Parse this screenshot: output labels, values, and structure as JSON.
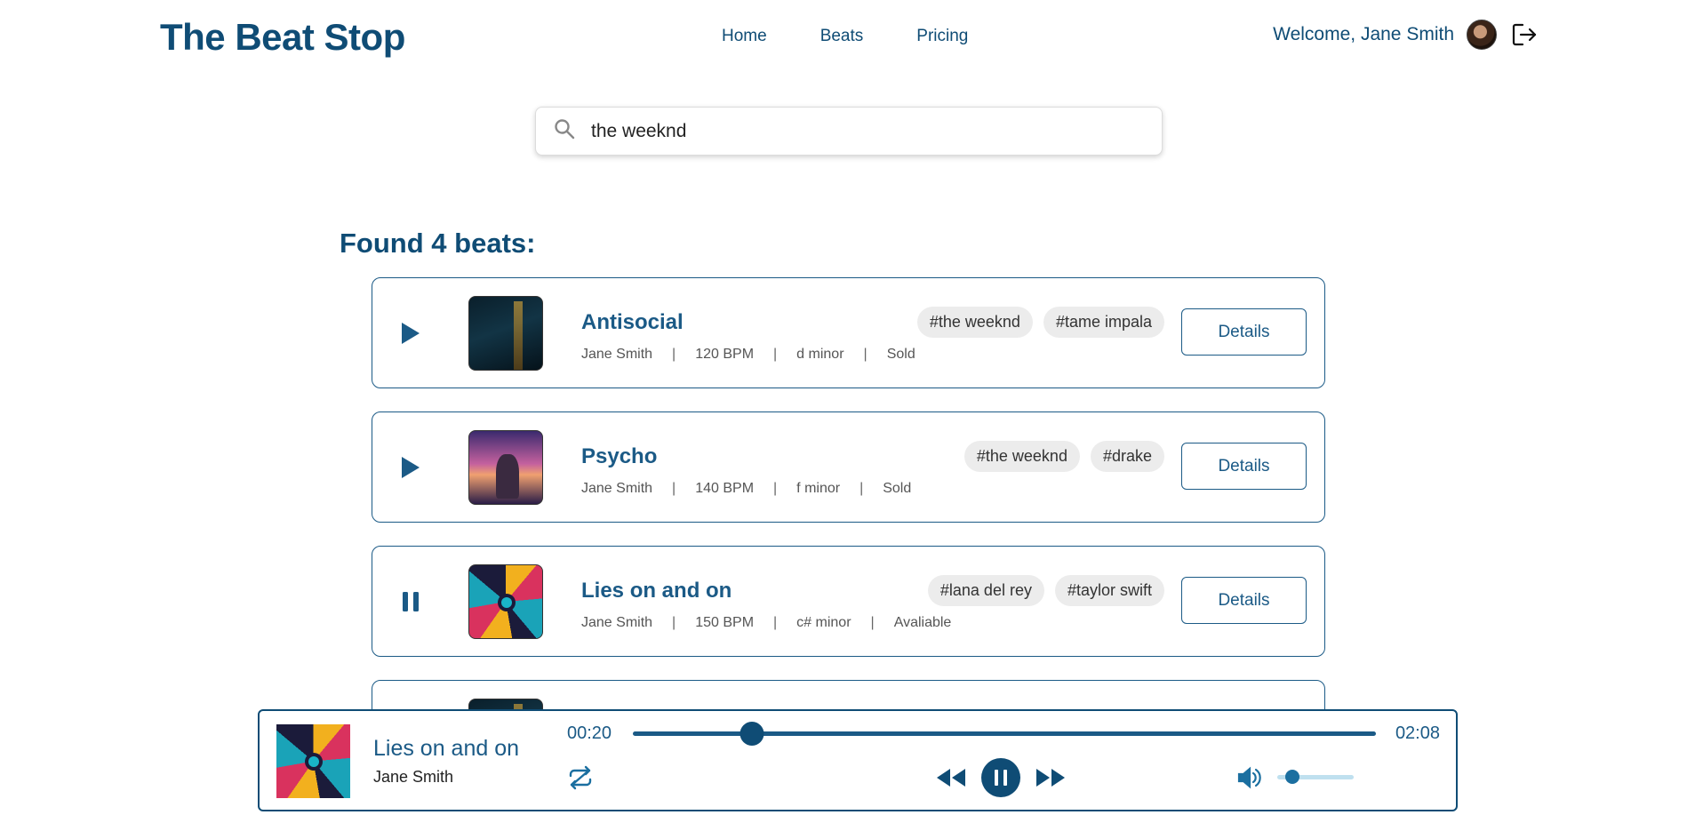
{
  "header": {
    "logo": "The Beat Stop",
    "nav": [
      "Home",
      "Beats",
      "Pricing"
    ],
    "welcome": "Welcome, Jane Smith"
  },
  "search": {
    "value": "the weeknd",
    "placeholder": ""
  },
  "results": {
    "heading": "Found 4 beats:",
    "beats": [
      {
        "title": "Antisocial",
        "artist": "Jane Smith",
        "bpm": "120 BPM",
        "key": "d minor",
        "status": "Sold",
        "tags": [
          "#the weeknd",
          "#tame impala"
        ],
        "details_label": "Details",
        "playing": false,
        "cover": "night-street-art"
      },
      {
        "title": "Psycho",
        "artist": "Jane Smith",
        "bpm": "140 BPM",
        "key": "f minor",
        "status": "Sold",
        "tags": [
          "#the weeknd",
          "#drake"
        ],
        "details_label": "Details",
        "playing": false,
        "cover": "car-sunset-art"
      },
      {
        "title": "Lies on and on",
        "artist": "Jane Smith",
        "bpm": "150 BPM",
        "key": "c# minor",
        "status": "Avaliable",
        "tags": [
          "#lana del rey",
          "#taylor swift"
        ],
        "details_label": "Details",
        "playing": true,
        "cover": "color-wheel-art"
      }
    ],
    "separator": "|"
  },
  "player": {
    "title": "Lies on and on",
    "artist": "Jane Smith",
    "current_time": "00:20",
    "total_time": "02:08",
    "progress": 0.16,
    "volume": 0.2,
    "state": "playing"
  },
  "colors": {
    "primary": "#0f4c75",
    "accent": "#1b5a86",
    "tag_bg": "#ececec"
  }
}
